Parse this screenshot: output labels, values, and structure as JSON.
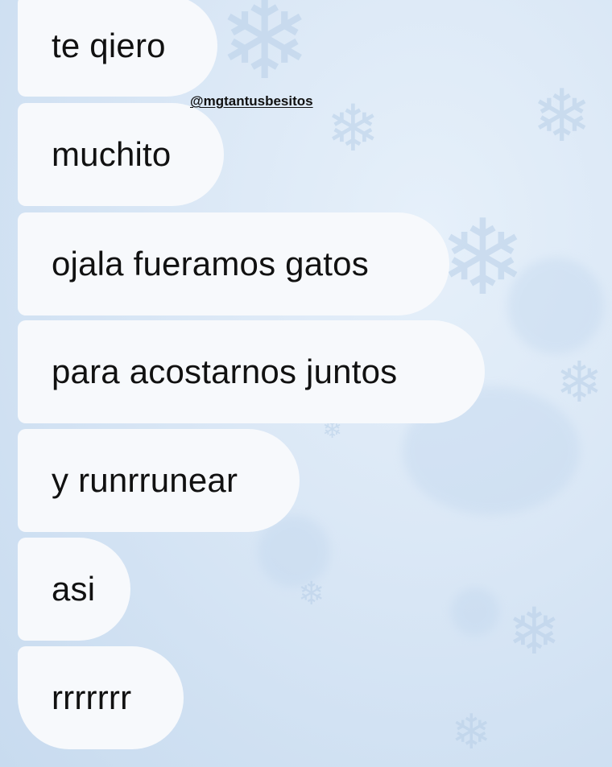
{
  "messages": [
    {
      "text": "te qiero"
    },
    {
      "text": "muchito"
    },
    {
      "text": "ojala fueramos gatos"
    },
    {
      "text": "para acostarnos juntos"
    },
    {
      "text": "y runrrunear"
    },
    {
      "text": "asi"
    },
    {
      "text": "rrrrrrr"
    }
  ],
  "mention_sticker": "@mgtantusbesitos",
  "background": {
    "theme": "winter-snowflakes",
    "colors": {
      "base": "#dbe8f6",
      "bubble": "#f7f9fc",
      "text": "#111111"
    },
    "icons": [
      "snowflake-icon"
    ]
  }
}
